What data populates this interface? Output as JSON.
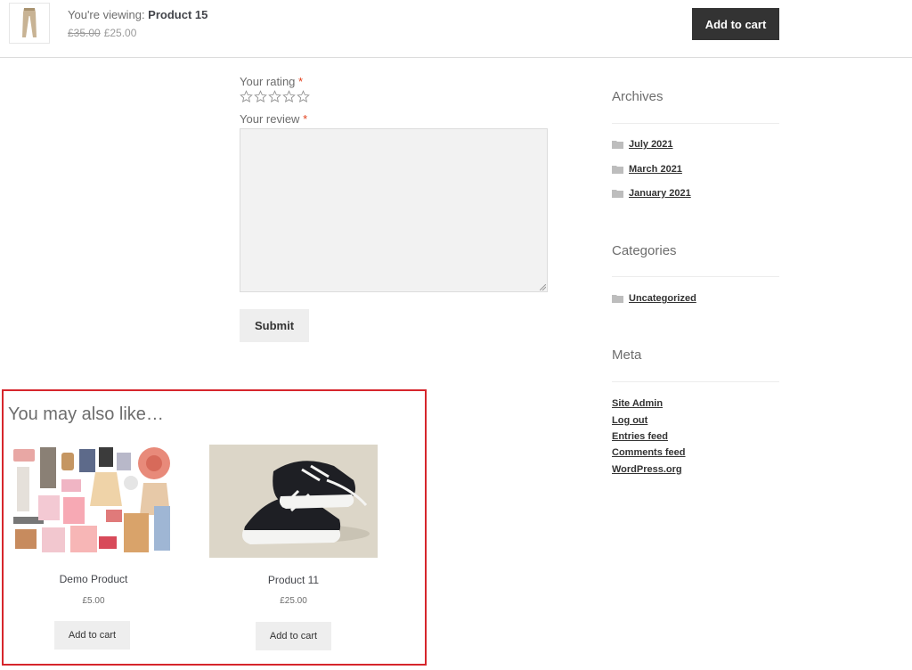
{
  "sticky_bar": {
    "viewing_prefix": "You're viewing: ",
    "product_name": "Product 15",
    "old_price": "£35.00",
    "price": "£25.00",
    "add_to_cart_label": "Add to cart"
  },
  "review_form": {
    "rating_label": "Your rating",
    "review_label": "Your review",
    "required_mark": "*",
    "rating_value": 0,
    "rating_max": 5,
    "review_value": "",
    "submit_label": "Submit"
  },
  "sidebar": {
    "archives_title": "Archives",
    "archives": [
      "July 2021",
      "March 2021",
      "January 2021"
    ],
    "categories_title": "Categories",
    "categories": [
      "Uncategorized"
    ],
    "meta_title": "Meta",
    "meta_links": [
      "Site Admin",
      "Log out",
      "Entries feed",
      "Comments feed",
      "WordPress.org"
    ]
  },
  "related": {
    "title": "You may also like…",
    "products": [
      {
        "name": "Demo Product",
        "price": "£5.00",
        "button_label": "Add to cart",
        "image_icon": "fashion-collage-image"
      },
      {
        "name": "Product 11",
        "price": "£25.00",
        "button_label": "Add to cart",
        "image_icon": "sneakers-image"
      }
    ]
  },
  "colors": {
    "dark_button": "#333333",
    "light_button": "#eeeeee",
    "required": "#e2401c",
    "highlight_frame": "#d6262c"
  }
}
